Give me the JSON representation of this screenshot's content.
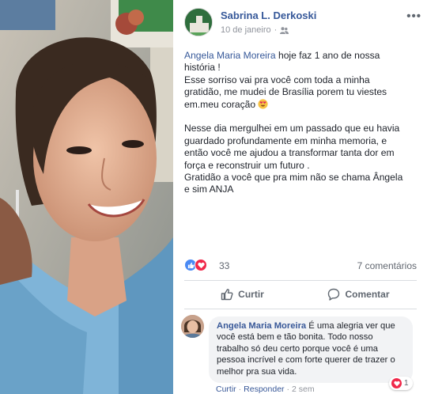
{
  "post": {
    "author": "Sabrina L. Derkoski",
    "date": "10 de janeiro",
    "audience_icon": "friends-icon",
    "mention": "Angela Maria Moreira",
    "line1_rest": " hoje faz 1 ano de nossa",
    "line2": "história !",
    "line3": "Esse sorriso vai pra você com toda a minha",
    "line4": "gratidão, me mudei de Brasília porem tu viestes",
    "line5": "em.meu coração",
    "line6": "Nesse dia mergulhei em um passado que eu havia",
    "line7": "guardado profundamente em minha memoria, e",
    "line8": "então você me ajudou a transformar tanta dor em",
    "line9": "força e reconstruir um futuro .",
    "line10": "Gratidão a você que pra mim não se chama Ângela",
    "line11": "e sim ANJA"
  },
  "reactions": {
    "count": "33",
    "comments": "7 comentários"
  },
  "actions": {
    "like": "Curtir",
    "comment": "Comentar"
  },
  "comment": {
    "author": "Angela Maria Moreira",
    "text": " É uma alegria ver que você está bem e tão bonita. Todo nosso trabalho só deu certo porque você é uma pessoa incrível e com forte querer de trazer o melhor pra sua vida.",
    "like": "Curtir",
    "reply": "Responder",
    "time": "2 sem",
    "reaction_count": "1"
  },
  "colors": {
    "link": "#365899",
    "like_blue": "#4a8af4",
    "love_red": "#f0284a",
    "muted": "#90949c"
  }
}
